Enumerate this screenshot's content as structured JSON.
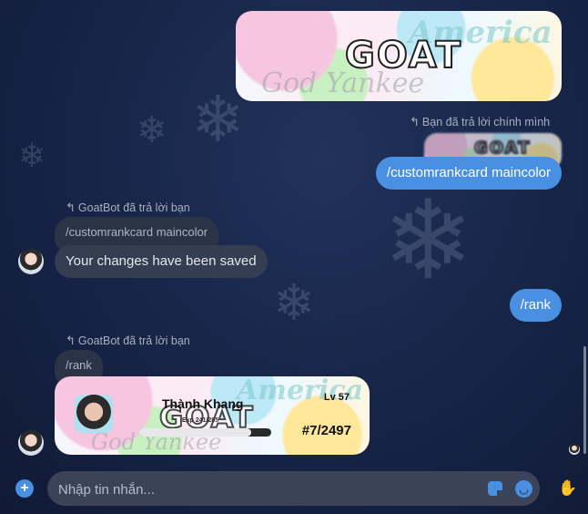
{
  "messages": {
    "self_reply_note": "Bạn đã trả lời chính mình",
    "sent_command_1": "/customrankcard maincolor",
    "bot_reply_note_1": "GoatBot đã trả lời bạn",
    "quoted_1": "/customrankcard maincolor",
    "bot_message_1": "Your changes have been saved",
    "sent_command_2": "/rank",
    "bot_reply_note_2": "GoatBot đã trả lời bạn",
    "quoted_2": "/rank"
  },
  "banner": {
    "watermark_top": "America",
    "logo_text": "GOAT",
    "watermark_bottom": "God Yankee"
  },
  "rank_card": {
    "name": "Thành Khang",
    "level": "Lv 57",
    "exp": "Exp 241/285",
    "exp_fraction": 0.846,
    "rank": "#7/2497"
  },
  "composer": {
    "placeholder": "Nhập tin nhắn..."
  },
  "icons": {
    "add": "plus-circle-icon",
    "sticker": "sticker-icon",
    "emoji": "emoji-icon",
    "send": "like-sticker-icon"
  },
  "colors": {
    "sent_bubble": "#4a90e2",
    "received_bubble": "#343d52",
    "accent": "#4a90e2"
  }
}
